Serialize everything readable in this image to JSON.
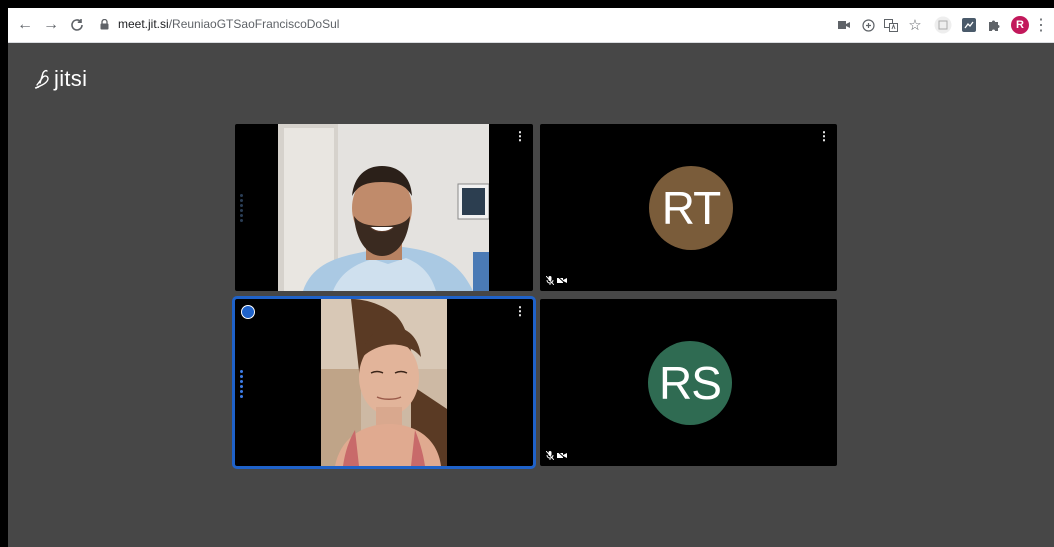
{
  "browser": {
    "url_host": "meet.jit.si",
    "url_path": "/ReuniaoGTSaoFranciscoDoSul",
    "profile_initial": "R",
    "icons": [
      "back-icon",
      "forward-icon",
      "reload-icon",
      "lock-icon",
      "camera-icon",
      "zoom-icon",
      "translate-icon",
      "star-icon",
      "extension-icon",
      "extension-icon",
      "puzzle-icon",
      "menu-icon"
    ]
  },
  "app": {
    "logo_text": "jitsi"
  },
  "tiles": [
    {
      "kind": "video",
      "label": ""
    },
    {
      "kind": "avatar",
      "initials": "RT",
      "color": "#7a5c3a"
    },
    {
      "kind": "video",
      "label": ""
    },
    {
      "kind": "avatar",
      "initials": "RS",
      "color": "#2f6b52"
    }
  ],
  "colors": {
    "background": "#474747",
    "active_border": "#1f62c9"
  }
}
